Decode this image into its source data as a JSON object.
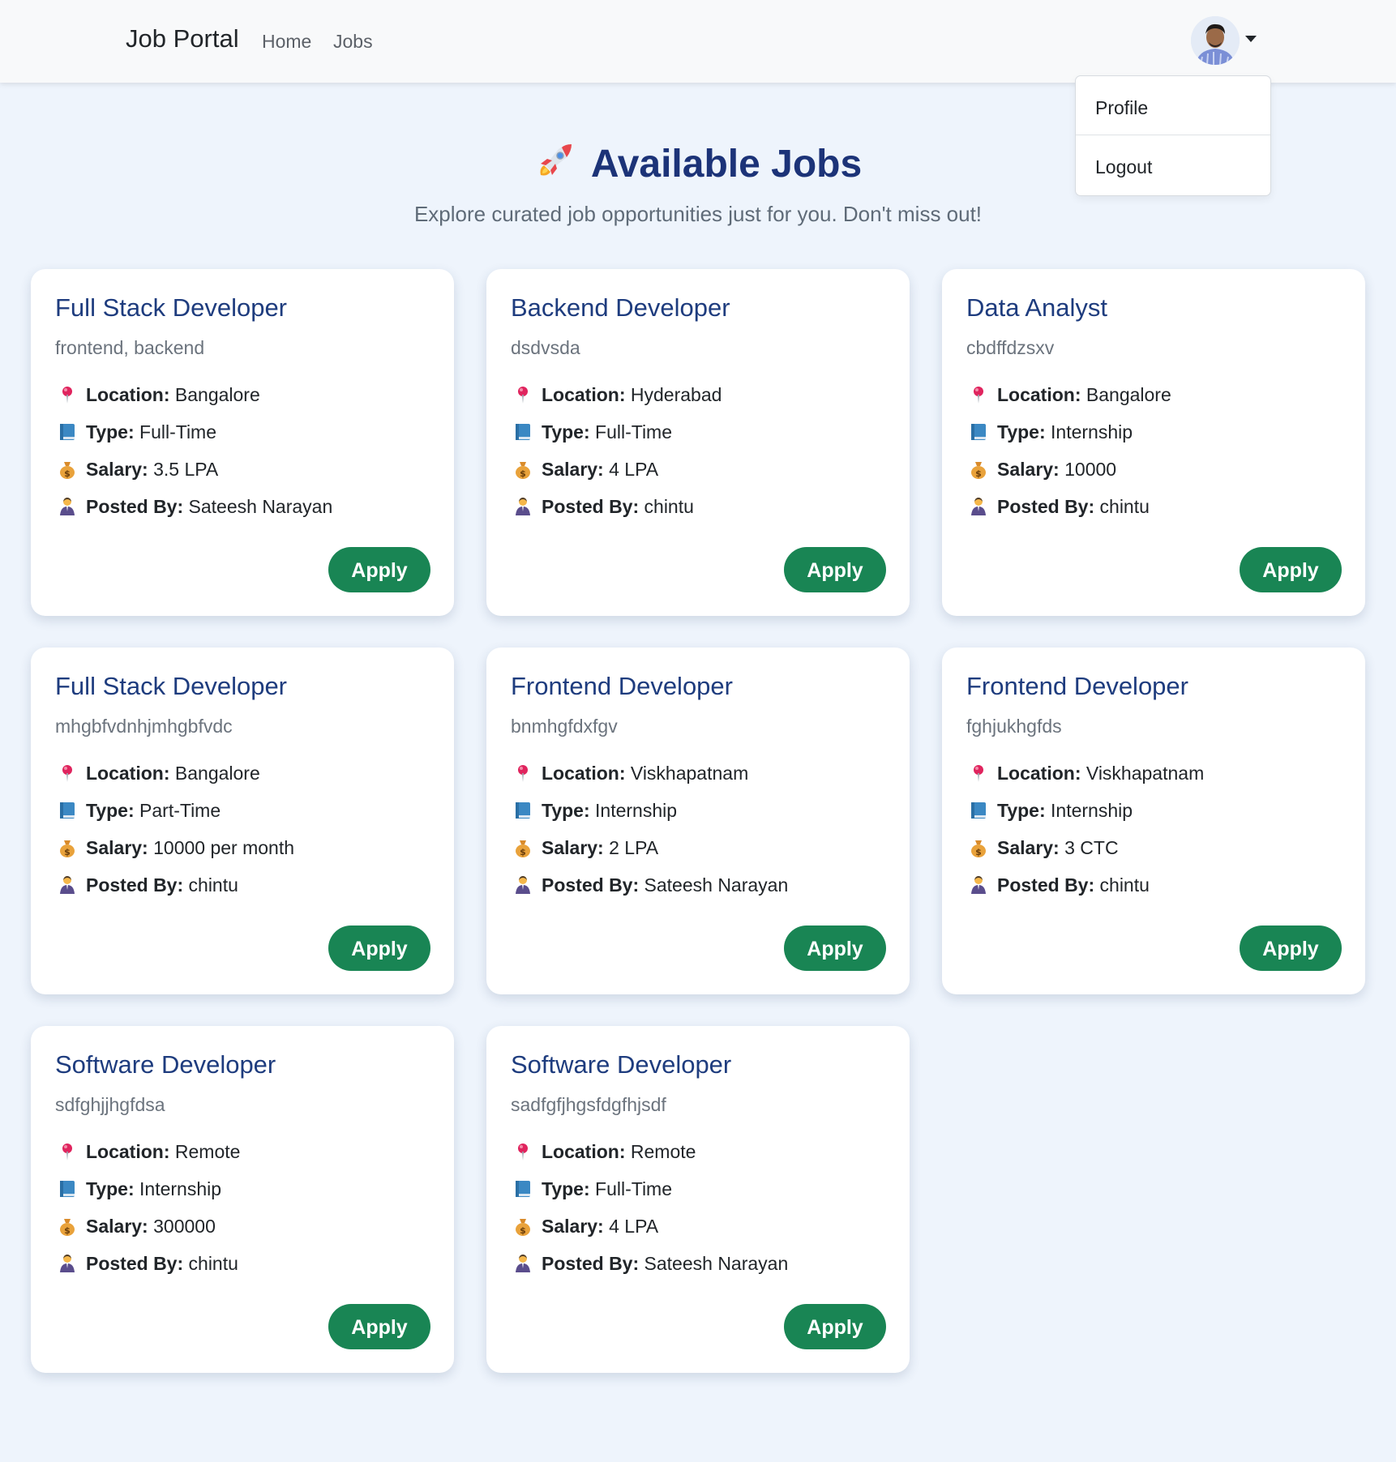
{
  "header": {
    "brand": "Job Portal",
    "nav": [
      "Home",
      "Jobs"
    ]
  },
  "user_menu": {
    "items": [
      "Profile",
      "Logout"
    ]
  },
  "hero": {
    "title": "Available Jobs",
    "subtitle": "Explore curated job opportunities just for you. Don't miss out!"
  },
  "labels": {
    "location": "Location:",
    "type": "Type:",
    "salary": "Salary:",
    "posted_by": "Posted By:",
    "apply": "Apply"
  },
  "colors": {
    "page_bg": "#eef4fc",
    "title": "#1c3378",
    "apply_button": "#198554"
  },
  "jobs": [
    {
      "title": "Full Stack Developer",
      "skills": "frontend, backend",
      "location": "Bangalore",
      "type": "Full-Time",
      "salary": "3.5 LPA",
      "posted_by": "Sateesh Narayan"
    },
    {
      "title": "Backend Developer",
      "skills": "dsdvsda",
      "location": "Hyderabad",
      "type": "Full-Time",
      "salary": "4 LPA",
      "posted_by": "chintu"
    },
    {
      "title": "Data Analyst",
      "skills": "cbdffdzsxv",
      "location": "Bangalore",
      "type": "Internship",
      "salary": "10000",
      "posted_by": "chintu"
    },
    {
      "title": "Full Stack Developer",
      "skills": "mhgbfvdnhjmhgbfvdc",
      "location": "Bangalore",
      "type": "Part-Time",
      "salary": "10000 per month",
      "posted_by": "chintu"
    },
    {
      "title": "Frontend Developer",
      "skills": "bnmhgfdxfgv",
      "location": "Viskhapatnam",
      "type": "Internship",
      "salary": "2 LPA",
      "posted_by": "Sateesh Narayan"
    },
    {
      "title": "Frontend Developer",
      "skills": "fghjukhgfds",
      "location": "Viskhapatnam",
      "type": "Internship",
      "salary": "3 CTC",
      "posted_by": "chintu"
    },
    {
      "title": "Software Developer",
      "skills": "sdfghjjhgfdsa",
      "location": "Remote",
      "type": "Internship",
      "salary": "300000",
      "posted_by": "chintu"
    },
    {
      "title": "Software Developer",
      "skills": "sadfgfjhgsfdgfhjsdf",
      "location": "Remote",
      "type": "Full-Time",
      "salary": "4 LPA",
      "posted_by": "Sateesh Narayan"
    }
  ]
}
